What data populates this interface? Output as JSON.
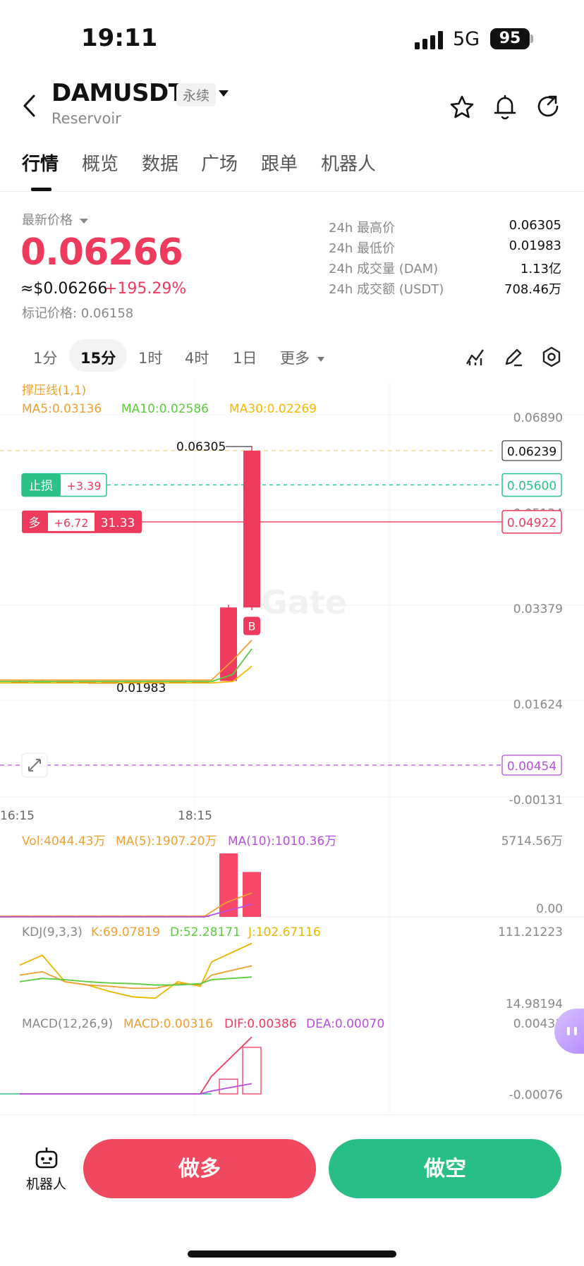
{
  "status_bar": {
    "time": "19:11",
    "network": "5G",
    "battery": "95"
  },
  "header": {
    "symbol": "DAMUSDT",
    "contract_type": "永续",
    "name": "Reservoir",
    "icons": [
      "back-icon",
      "star-icon",
      "bell-icon",
      "share-icon"
    ]
  },
  "tabs": [
    "行情",
    "概览",
    "数据",
    "广场",
    "跟单",
    "机器人"
  ],
  "price": {
    "last_label": "最新价格",
    "last": "0.06266",
    "usd": "≈$0.06266",
    "change": "+195.29%",
    "mark": "标记价格: 0.06158"
  },
  "stats": [
    {
      "label": "24h 最高价",
      "value": "0.06305"
    },
    {
      "label": "24h 最低价",
      "value": "0.01983"
    },
    {
      "label": "24h 成交量 (DAM)",
      "value": "1.13亿"
    },
    {
      "label": "24h 成交额 (USDT)",
      "value": "708.46万"
    }
  ],
  "timeframes": [
    "1分",
    "15分",
    "1时",
    "4时",
    "1日",
    "更多"
  ],
  "active_timeframe": "15分",
  "chart_data": {
    "type": "candlestick",
    "indicator_title": "撑压线(1,1)",
    "ma_labels": [
      "MA5:0.03136",
      "MA10:0.02586",
      "MA30:0.02269"
    ],
    "y_ticks": [
      "0.06890",
      "0.05134",
      "0.03379",
      "0.01624",
      "-0.00131"
    ],
    "ylim": [
      -0.00131,
      0.0689
    ],
    "x_ticks": [
      "16:15",
      "18:15"
    ],
    "high_marker": "0.06305",
    "low_marker": "0.01983",
    "price_line": "0.06239",
    "stop_loss": {
      "label": "止损",
      "pnl": "+3.39",
      "price": "0.05600",
      "value": 0.056
    },
    "position": {
      "side": "多",
      "pnl": "+6.72",
      "size": "31.33",
      "price": "0.04922",
      "value": 0.04922
    },
    "alert_line": {
      "price": "0.00454",
      "value": 0.00454
    },
    "buy_marker": "B",
    "watermark": "Gate",
    "candles": [
      {
        "o": 0.0199,
        "h": 0.0201,
        "l": 0.0197,
        "c": 0.02
      },
      {
        "o": 0.02,
        "h": 0.0201,
        "l": 0.0198,
        "c": 0.0199
      },
      {
        "o": 0.0199,
        "h": 0.02,
        "l": 0.0198,
        "c": 0.0199
      },
      {
        "o": 0.0199,
        "h": 0.02,
        "l": 0.0198,
        "c": 0.0199
      },
      {
        "o": 0.0199,
        "h": 0.02,
        "l": 0.01983,
        "c": 0.0199
      },
      {
        "o": 0.0199,
        "h": 0.02,
        "l": 0.0198,
        "c": 0.0199
      },
      {
        "o": 0.0199,
        "h": 0.02,
        "l": 0.0198,
        "c": 0.0199
      },
      {
        "o": 0.0199,
        "h": 0.02,
        "l": 0.0198,
        "c": 0.0199
      },
      {
        "o": 0.0199,
        "h": 0.02,
        "l": 0.0198,
        "c": 0.02
      },
      {
        "o": 0.02,
        "h": 0.034,
        "l": 0.0198,
        "c": 0.0335
      },
      {
        "o": 0.0335,
        "h": 0.06305,
        "l": 0.033,
        "c": 0.0623
      }
    ],
    "volume": {
      "labels": [
        "Vol:4044.43万",
        "MA(5):1907.20万",
        "MA(10):1010.36万"
      ],
      "y_ticks": [
        "5714.56万",
        "0.00"
      ],
      "bars": [
        40,
        30,
        25,
        35,
        20,
        30,
        28,
        22,
        30,
        5714,
        4044
      ]
    },
    "kdj": {
      "labels": [
        "KDJ(9,3,3)",
        "K:69.07819",
        "D:52.28171",
        "J:102.67116"
      ],
      "y_ticks": [
        "111.21223",
        "14.98194"
      ],
      "K": [
        55,
        60,
        45,
        40,
        38,
        35,
        35,
        42,
        40,
        55,
        69
      ],
      "D": [
        45,
        50,
        48,
        45,
        43,
        42,
        40,
        40,
        42,
        48,
        52
      ],
      "J": [
        70,
        85,
        45,
        40,
        30,
        22,
        20,
        45,
        38,
        75,
        103
      ]
    },
    "macd": {
      "labels": [
        "MACD(12,26,9)",
        "MACD:0.00316",
        "DIF:0.00386",
        "DEA:0.00070"
      ],
      "y_ticks": [
        "0.00431",
        "-0.00076"
      ],
      "hist": [
        0,
        0,
        1e-05,
        1e-05,
        1e-05,
        0,
        0,
        0,
        1e-05,
        0.001,
        0.00316
      ],
      "DIF": [
        0,
        0,
        0,
        0,
        0,
        0,
        0,
        0,
        0,
        0.0012,
        0.00386
      ],
      "DEA": [
        0,
        0,
        0,
        0,
        0,
        0,
        0,
        0,
        0,
        0.0002,
        0.0007
      ]
    }
  },
  "bottom_bar": {
    "robot_label": "机器人",
    "long_label": "做多",
    "short_label": "做空"
  },
  "colors": {
    "up": "#ee3b5d",
    "down": "#2bc287",
    "ma5": "#f0a030",
    "ma10": "#5ccc3c",
    "ma30": "#f5b800",
    "purple": "#b94de0"
  }
}
